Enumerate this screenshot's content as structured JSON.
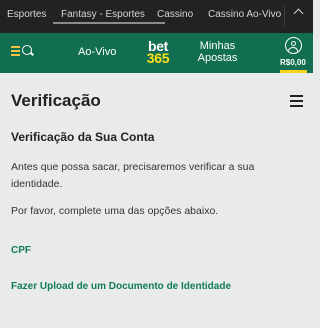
{
  "topbar": {
    "tabs": [
      "Esportes",
      "Fantasy - Esportes",
      "Cassino",
      "Cassino Ao-Vivo"
    ]
  },
  "header": {
    "live_label": "Ao-Vivo",
    "logo_top": "bet",
    "logo_bottom": "365",
    "my_bets_line1": "Minhas",
    "my_bets_line2": "Apostas",
    "balance": "R$0,00"
  },
  "page": {
    "title": "Verificação",
    "section_title": "Verificação da Sua Conta",
    "paragraph1": "Antes que possa sacar, precisaremos verificar a sua identidade.",
    "paragraph2": "Por favor, complete uma das opções abaixo.",
    "option_cpf": "CPF",
    "option_upload": "Fazer Upload de um Documento de Identidade"
  },
  "colors": {
    "header_green": "#126e51",
    "accent_yellow": "#f6d322",
    "link_green": "#127b58"
  }
}
